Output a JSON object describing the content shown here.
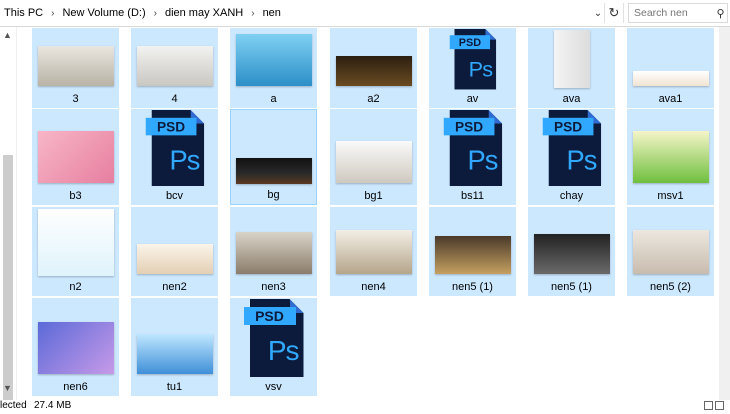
{
  "address": {
    "crumbs": [
      "This PC",
      "New Volume (D:)",
      "dien may XANH",
      "nen"
    ],
    "separator": "›"
  },
  "search": {
    "placeholder": "Search nen"
  },
  "status": {
    "selected_text": "lected",
    "size_text": "27.4 MB"
  },
  "colors": {
    "selection": "#cce8ff",
    "psd_dark": "#0c1a3b",
    "psd_blue": "#31a8ff"
  },
  "files": [
    {
      "name": "3",
      "kind": "image"
    },
    {
      "name": "4",
      "kind": "image"
    },
    {
      "name": "a",
      "kind": "image"
    },
    {
      "name": "a2",
      "kind": "image"
    },
    {
      "name": "av",
      "kind": "psd"
    },
    {
      "name": "ava",
      "kind": "image"
    },
    {
      "name": "ava1",
      "kind": "image"
    },
    {
      "name": "b3",
      "kind": "image"
    },
    {
      "name": "bcv",
      "kind": "psd"
    },
    {
      "name": "bg",
      "kind": "image"
    },
    {
      "name": "bg1",
      "kind": "image"
    },
    {
      "name": "bs11",
      "kind": "psd"
    },
    {
      "name": "chay",
      "kind": "psd"
    },
    {
      "name": "msv1",
      "kind": "image"
    },
    {
      "name": "n2",
      "kind": "image"
    },
    {
      "name": "nen2",
      "kind": "image"
    },
    {
      "name": "nen3",
      "kind": "image"
    },
    {
      "name": "nen4",
      "kind": "image"
    },
    {
      "name": "nen5 (1)",
      "kind": "image"
    },
    {
      "name": "nen5 (1)",
      "kind": "image"
    },
    {
      "name": "nen5 (2)",
      "kind": "image"
    },
    {
      "name": "nen6",
      "kind": "image"
    },
    {
      "name": "tu1",
      "kind": "image"
    },
    {
      "name": "vsv",
      "kind": "psd"
    }
  ],
  "psd_label": "PSD",
  "ps_label": "Ps"
}
